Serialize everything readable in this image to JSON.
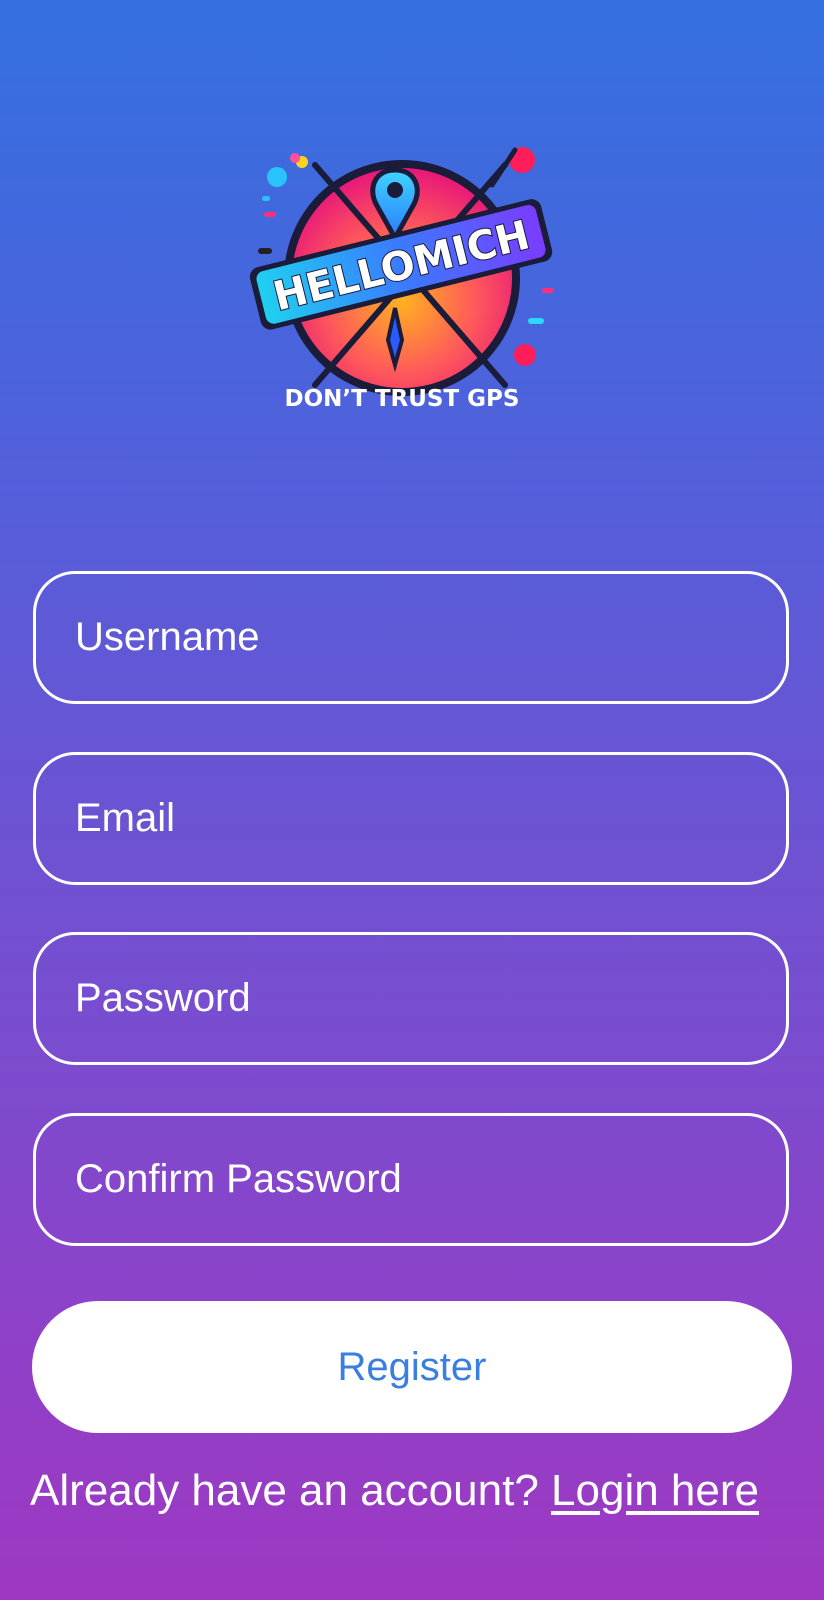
{
  "logo": {
    "name": "HELLOMICH",
    "tagline": "DON’T TRUST GPS"
  },
  "form": {
    "username_placeholder": "Username",
    "email_placeholder": "Email",
    "password_placeholder": "Password",
    "confirm_placeholder": "Confirm Password",
    "register_label": "Register"
  },
  "footer": {
    "prompt": "Already have an account?",
    "link": "Login here"
  },
  "colors": {
    "gradient_top": "#3470e0",
    "gradient_bottom": "#9e38c2",
    "button_text": "#3a7fe0"
  }
}
